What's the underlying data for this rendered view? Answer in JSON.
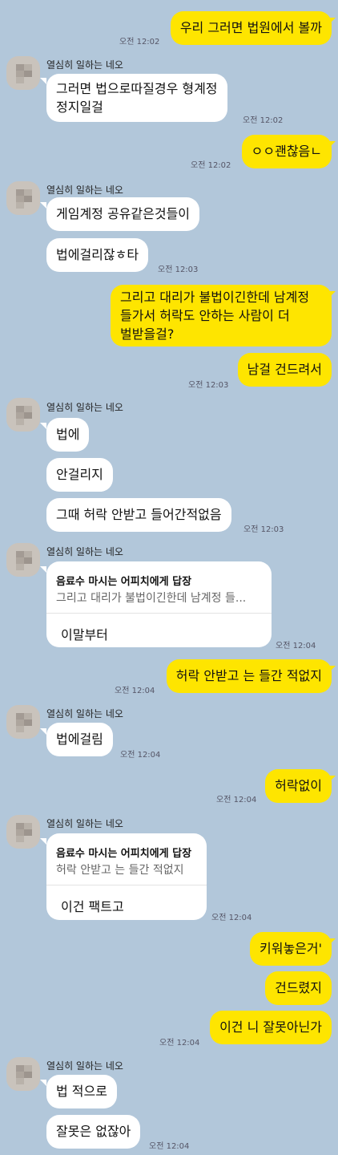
{
  "chat": {
    "colors": {
      "background": "#b2c7da",
      "my_bubble": "#fee500",
      "their_bubble": "#ffffff"
    },
    "sender_name": "열심히 일하는 네오",
    "messages": {
      "m1": "우리 그러면 법원에서 볼까",
      "m2": "그러면 법으로따질경우 형계정\n정지일걸",
      "m3": "ㅇㅇ괜찮음ㄴ",
      "m4": "게임계정 공유같은것들이",
      "m5": "법에걸리잖ㅎ타",
      "m6": "그리고 대리가 불법이긴한데 남계정\n들가서 허락도 안하는 사람이 더\n벌받을걸?",
      "m7": "남걸 건드려서",
      "m8": "법에",
      "m9": "안걸리지",
      "m10": "그때 허락 안받고 들어간적없음",
      "r1_msg": "이말부터",
      "m11": "허락 안받고 는 들간 적없지",
      "m12": "법에걸림",
      "m13": "허락없이",
      "r2_msg": "이건 팩트고",
      "m14": "키워놓은거'",
      "m15": "건드렸지",
      "m16": "이건 니 잘못아닌가",
      "m17": "법 적으로",
      "m18": "잘못은 없잖아"
    },
    "replies": {
      "r1": {
        "title": "음료수 마시는 어피치에게 답장",
        "quote": "그리고 대리가 불법이긴한데 남계정 들..."
      },
      "r2": {
        "title": "음료수 마시는 어피치에게 답장",
        "quote": "허락 안받고 는 들간 적없지"
      }
    },
    "times": {
      "t1": "오전 12:02",
      "t2": "오전 12:02",
      "t3": "오전 12:02",
      "t4": "오전 12:03",
      "t5": "오전 12:03",
      "t6": "오전 12:03",
      "t7": "오전 12:04",
      "t8": "오전 12:04",
      "t9": "오전 12:04",
      "t10": "오전 12:04",
      "t11": "오전 12:04",
      "t12": "오전 12:04",
      "t13": "오전 12:04"
    }
  }
}
